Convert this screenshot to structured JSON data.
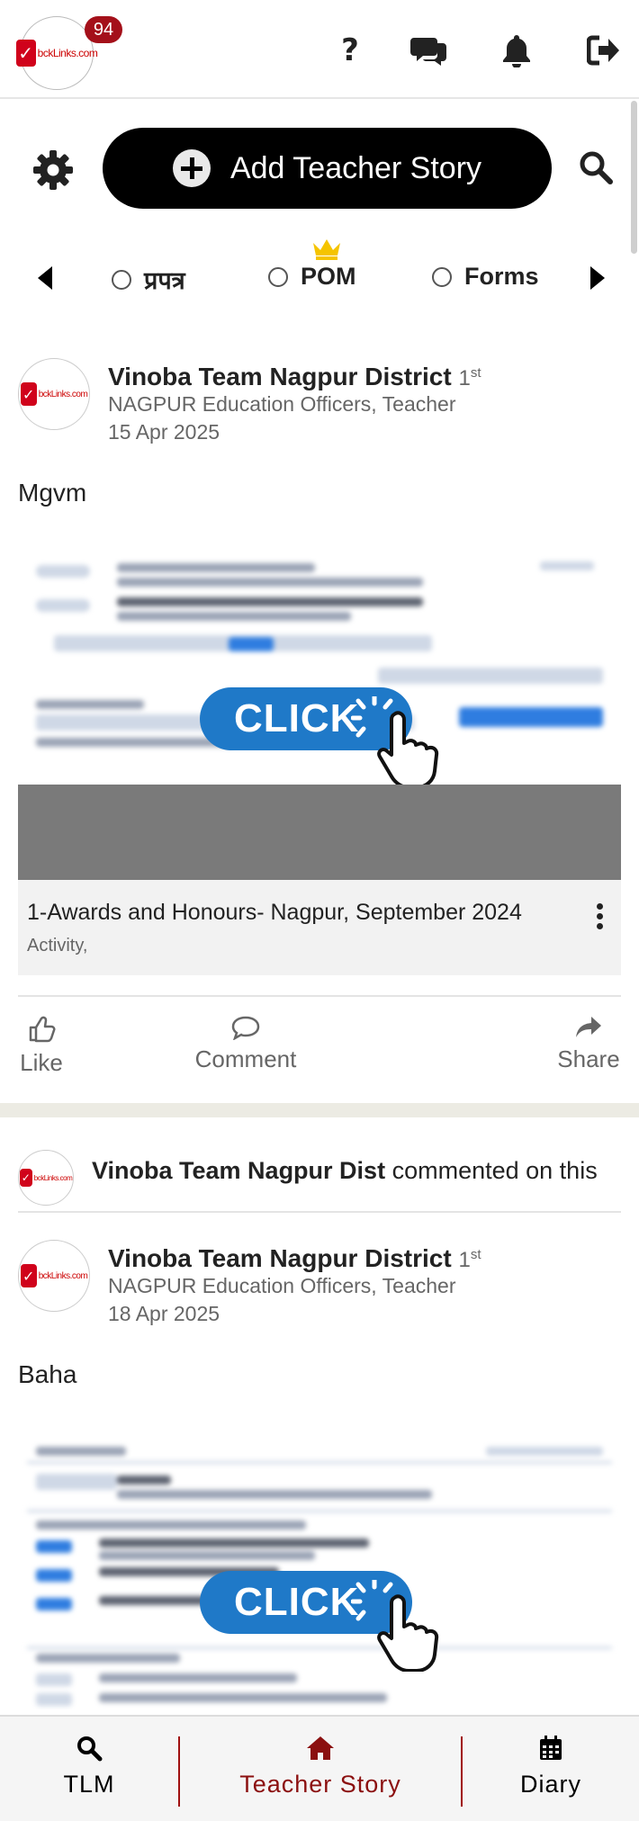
{
  "header": {
    "logo_text": "bckLinks.com",
    "notification_count": "94",
    "icons": [
      "help-icon",
      "chat-icon",
      "bell-icon",
      "logout-icon"
    ]
  },
  "toolbar": {
    "add_story_label": "Add Teacher Story",
    "icons": [
      "gear-icon",
      "plus-circle-icon",
      "search-icon"
    ]
  },
  "filters": {
    "options": [
      {
        "label": "प्रपत्र",
        "selected": false
      },
      {
        "label": "POM",
        "selected": false,
        "crown": true
      },
      {
        "label": "Forms",
        "selected": false
      }
    ]
  },
  "posts": [
    {
      "author": "Vinoba Team Nagpur District",
      "degree": "1",
      "degree_suffix": "st",
      "role": "NAGPUR Education Officers, Teacher",
      "date": "15 Apr 2025",
      "text": "Mgvm",
      "overlay_label": "CLICK",
      "caption_title": "1-Awards and Honours- Nagpur, September 2024",
      "caption_sub": "Activity,",
      "actions": {
        "like": "Like",
        "comment": "Comment",
        "share": "Share"
      }
    },
    {
      "commented_by": "Vinoba Team Nagpur Dist",
      "commented_suffix": "commented on this",
      "author": "Vinoba Team Nagpur District",
      "degree": "1",
      "degree_suffix": "st",
      "role": "NAGPUR Education Officers, Teacher",
      "date": "18 Apr 2025",
      "text": "Baha",
      "overlay_label": "CLICK"
    }
  ],
  "bottom_nav": {
    "items": [
      {
        "label": "TLM",
        "icon": "search-icon",
        "active": false
      },
      {
        "label": "Teacher Story",
        "icon": "home-icon",
        "active": true
      },
      {
        "label": "Diary",
        "icon": "calendar-icon",
        "active": false
      }
    ]
  },
  "colors": {
    "badge": "#a4101a",
    "active_nav": "#8b1010",
    "click_blue": "#1f79c8",
    "crown": "#f5c400"
  }
}
